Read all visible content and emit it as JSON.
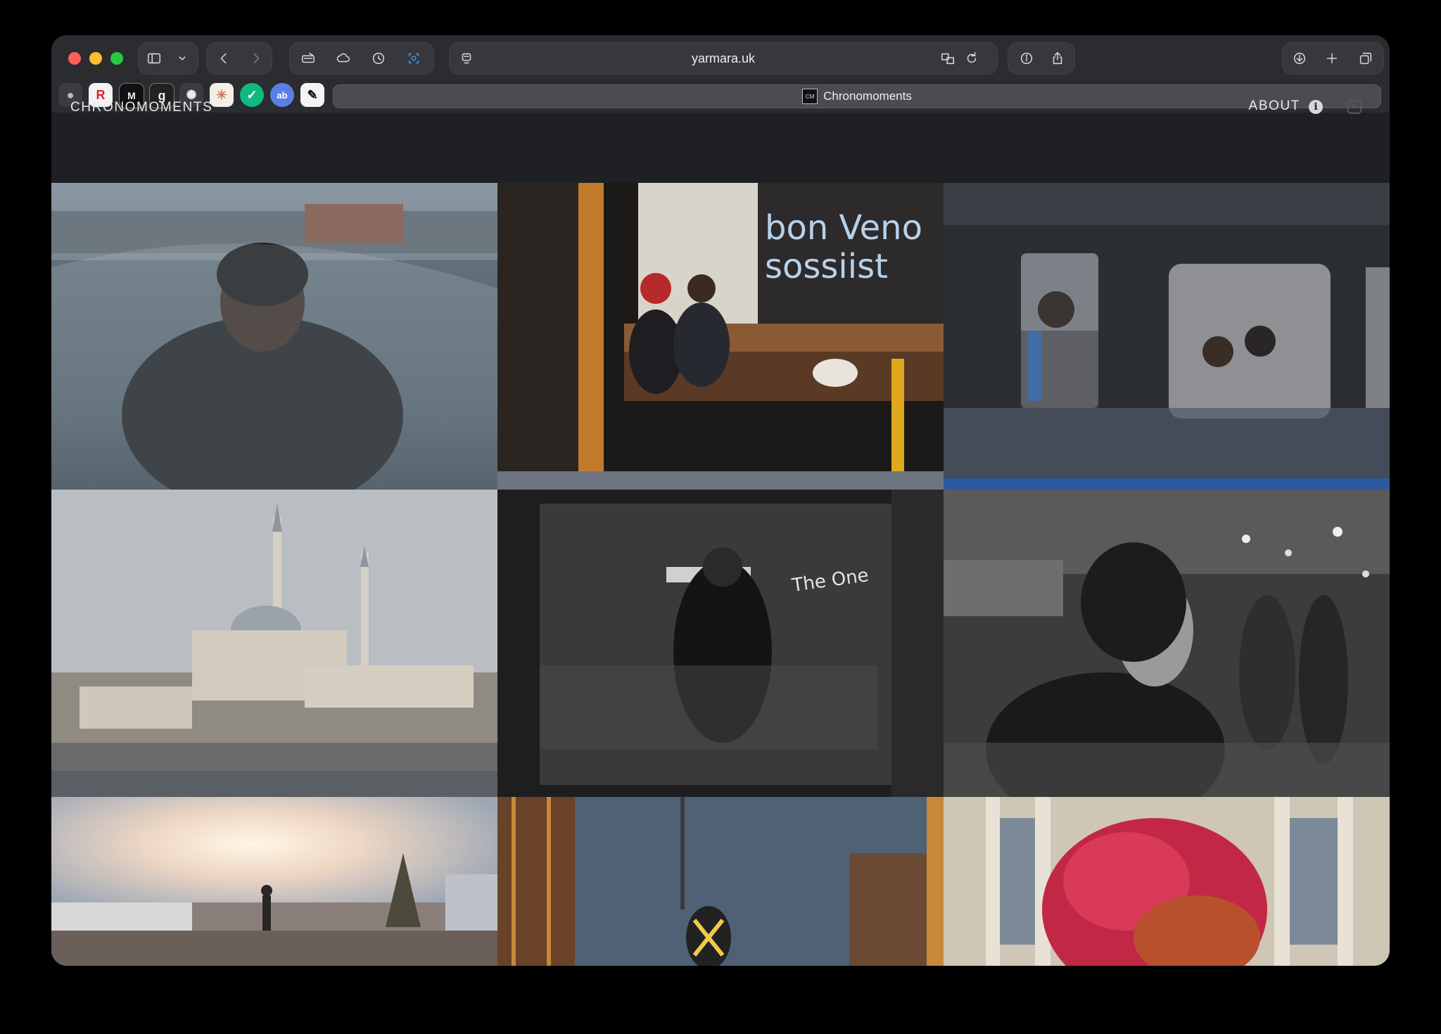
{
  "browser": {
    "url": "yarmara.uk",
    "tab_title": "Chronomoments",
    "favicon_text": "CM",
    "bookmarks": [
      "apple",
      "R",
      "M",
      "g",
      "openai",
      "claude",
      "check",
      "ab",
      "pen"
    ]
  },
  "site": {
    "brand": "CHRONOMOMENTS",
    "about_label": "ABOUT",
    "info_icon": "i"
  },
  "gallery": {
    "photos": [
      {
        "name": "photo-man-under-plastic"
      },
      {
        "name": "photo-cafe-neon-cat"
      },
      {
        "name": "photo-people-behind-rainy-glass"
      },
      {
        "name": "photo-mosque"
      },
      {
        "name": "photo-reflection-bw"
      },
      {
        "name": "photo-woman-smoking-bw"
      },
      {
        "name": "photo-waterfront-sunset"
      },
      {
        "name": "photo-crane-worker"
      },
      {
        "name": "photo-red-tree"
      }
    ]
  },
  "colors": {
    "page_bg": "#1e2024",
    "toolbar_bg": "#2a2c30",
    "accent_blue": "#4a90e2"
  }
}
